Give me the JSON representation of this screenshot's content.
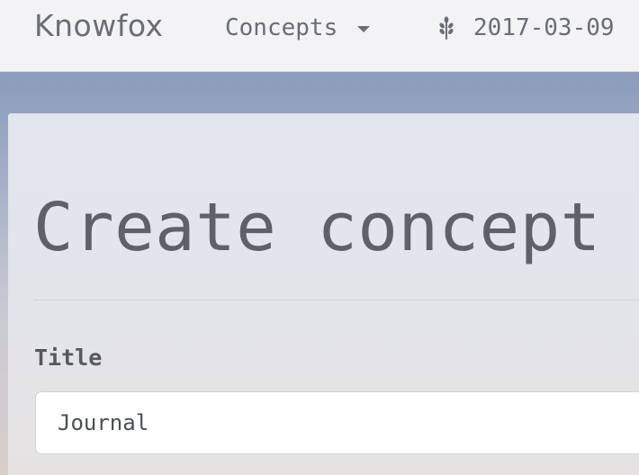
{
  "navbar": {
    "brand": "Knowfox",
    "concepts_label": "Concepts",
    "date_label": "2017-03-09",
    "date_icon": "grain-icon"
  },
  "main": {
    "page_title": "Create concept",
    "title_field": {
      "label": "Title",
      "value": "Journal",
      "placeholder": ""
    }
  }
}
